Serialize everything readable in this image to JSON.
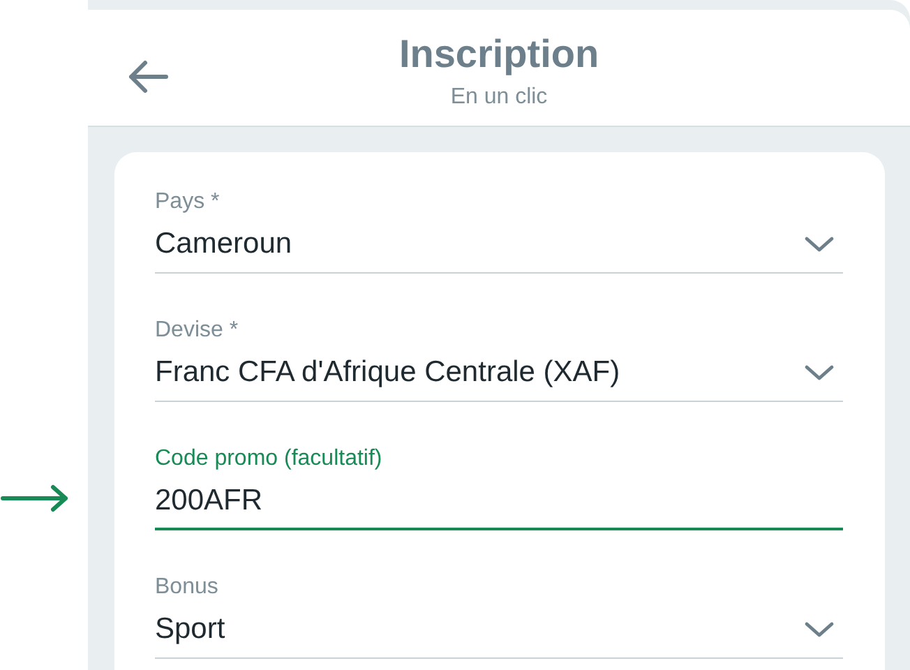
{
  "header": {
    "title": "Inscription",
    "subtitle": "En un clic"
  },
  "fields": [
    {
      "kind": "select",
      "label": "Pays *",
      "value": "Cameroun",
      "focused": false,
      "pointed": false
    },
    {
      "kind": "select",
      "label": "Devise *",
      "value": "Franc CFA d'Afrique Centrale (XAF)",
      "focused": false,
      "pointed": false
    },
    {
      "kind": "text",
      "label": "Code promo (facultatif)",
      "value": "200AFR",
      "focused": true,
      "pointed": true
    },
    {
      "kind": "select",
      "label": "Bonus",
      "value": "Sport",
      "focused": false,
      "pointed": false
    }
  ]
}
